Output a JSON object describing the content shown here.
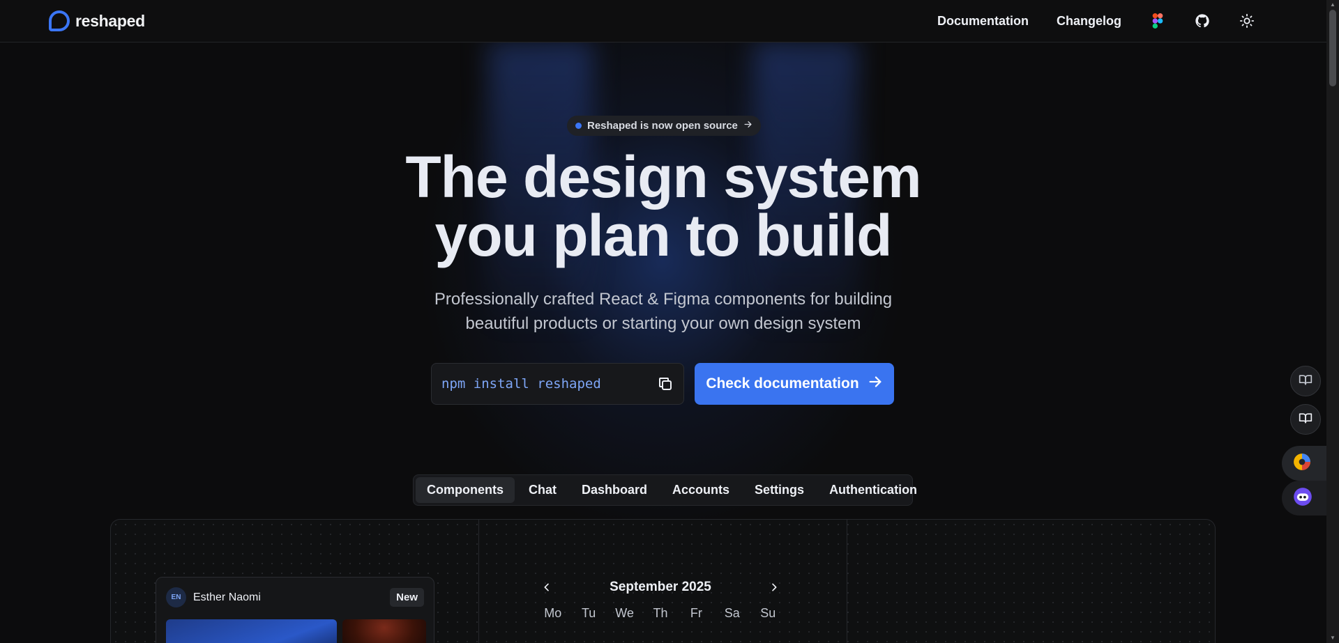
{
  "nav": {
    "logo_text": "reshaped",
    "links": [
      {
        "label": "Documentation"
      },
      {
        "label": "Changelog"
      }
    ],
    "icons": [
      "figma-icon",
      "github-icon",
      "sun-icon"
    ]
  },
  "hero": {
    "announcement": "Reshaped is now open source",
    "headline_line1": "The design system",
    "headline_line2": "you plan to build",
    "subhead_line1": "Professionally crafted React & Figma components for building",
    "subhead_line2": "beautiful products or starting your own design system",
    "install_command": "npm install reshaped",
    "cta_label": "Check documentation"
  },
  "tabs": [
    {
      "label": "Components",
      "active": true
    },
    {
      "label": "Chat",
      "active": false
    },
    {
      "label": "Dashboard",
      "active": false
    },
    {
      "label": "Accounts",
      "active": false
    },
    {
      "label": "Settings",
      "active": false
    },
    {
      "label": "Authentication",
      "active": false
    }
  ],
  "preview": {
    "card": {
      "avatar_initials": "EN",
      "name": "Esther Naomi",
      "badge": "New"
    },
    "calendar": {
      "month": "September 2025",
      "weekdays": [
        "Mo",
        "Tu",
        "We",
        "Th",
        "Fr",
        "Sa",
        "Su"
      ]
    }
  },
  "colors": {
    "accent": "#3a74f0",
    "background": "#0c0c0d",
    "install_text": "#7ea6f7"
  }
}
